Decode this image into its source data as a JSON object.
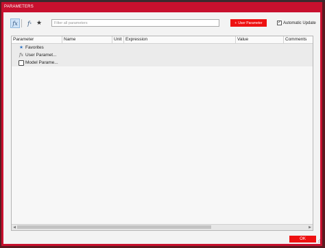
{
  "window": {
    "title": "PARAMETERS"
  },
  "toolbar": {
    "search_placeholder": "Filter all parameters",
    "user_parameter_button": "User Parameter",
    "auto_update_label": "Automatic Update",
    "auto_update_checked": true
  },
  "table": {
    "columns": [
      "Parameter",
      "Name",
      "Unit",
      "Expression",
      "Value",
      "Comments"
    ],
    "rows": [
      {
        "icon": "star-icon",
        "label": "Favorites"
      },
      {
        "icon": "fx-icon",
        "label": "User Paramet..."
      },
      {
        "icon": "model-icon",
        "label": "Model Parame..."
      }
    ]
  },
  "footer": {
    "ok_label": "OK"
  },
  "colors": {
    "accent": "#ee1111",
    "frame": "#c8102e"
  }
}
